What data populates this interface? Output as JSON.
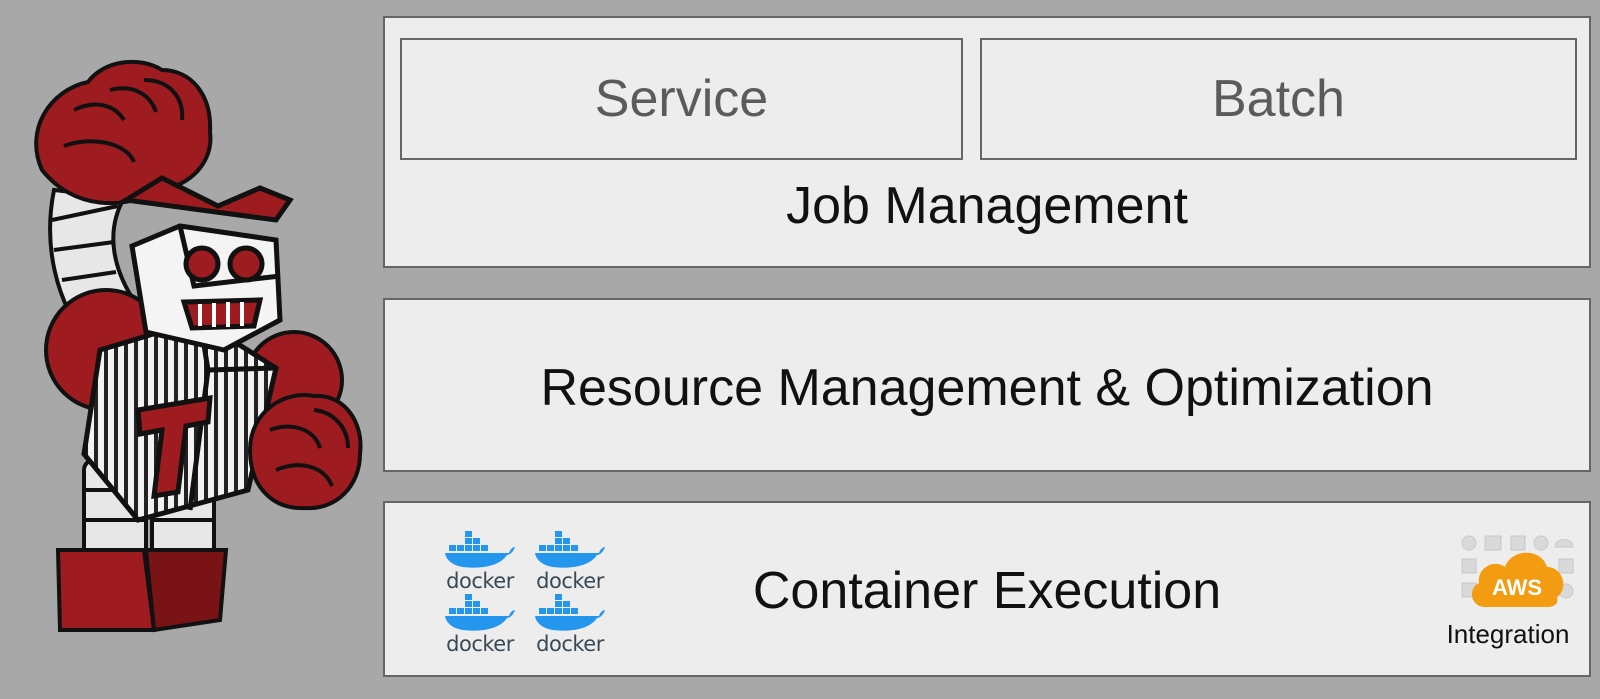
{
  "job_management": {
    "title": "Job Management",
    "service_label": "Service",
    "batch_label": "Batch"
  },
  "resource_management": {
    "title": "Resource Management & Optimization"
  },
  "container_execution": {
    "title": "Container Execution",
    "docker_logos": [
      "docker",
      "docker",
      "docker",
      "docker"
    ],
    "aws_badge": "AWS",
    "aws_caption": "Integration"
  },
  "mascot": {
    "chest_letter": "T"
  },
  "colors": {
    "background": "#a8a8a8",
    "panel": "#ededed",
    "border": "#666666",
    "mascot_red": "#9e1b1f",
    "docker_blue": "#2496ed",
    "aws_orange": "#f39c12"
  },
  "icons": {
    "mascot": "robot-mascot-icon",
    "docker": "docker-whale-icon",
    "aws": "aws-cloud-icon"
  }
}
